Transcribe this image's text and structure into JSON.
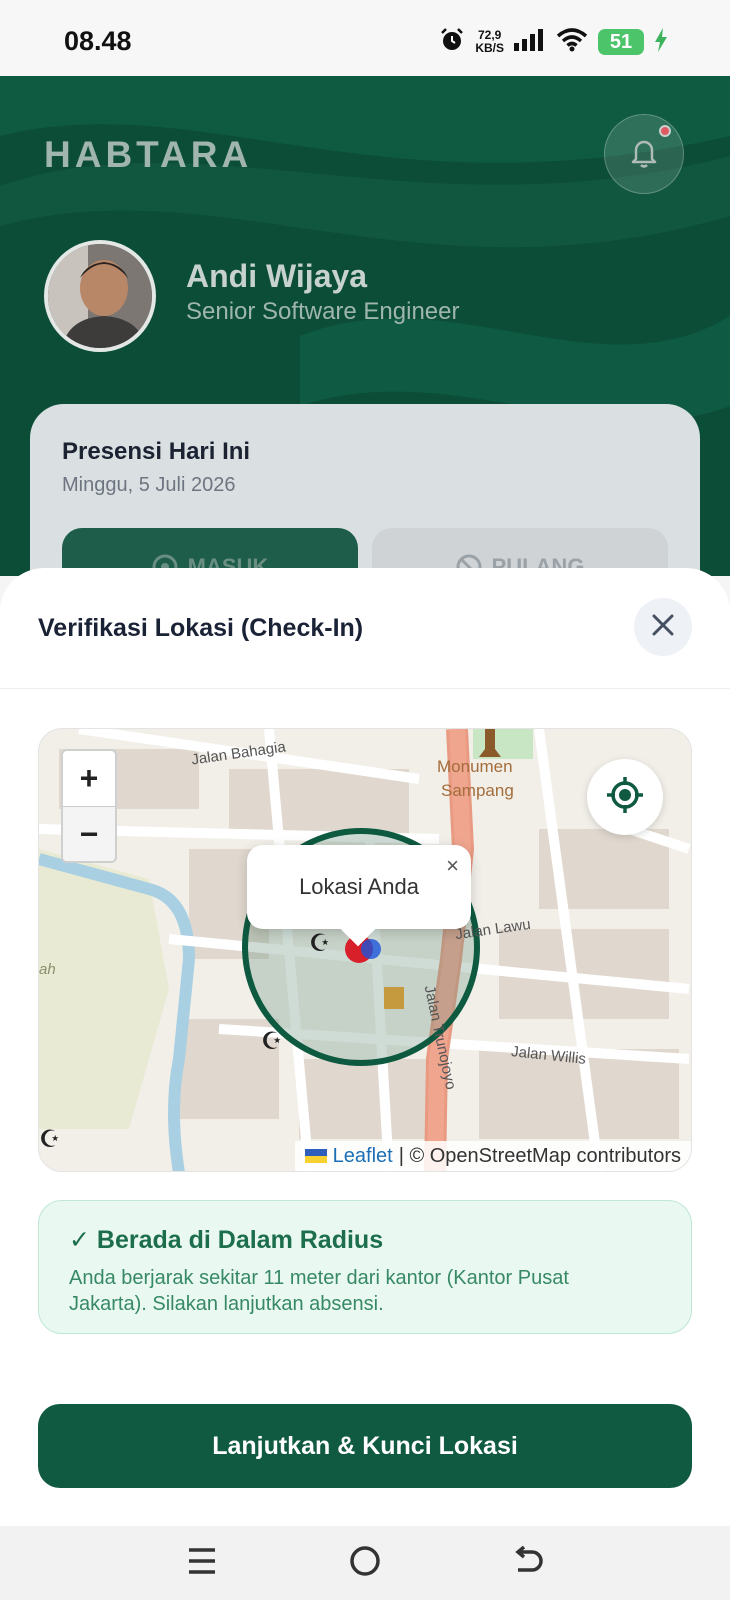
{
  "status_bar": {
    "time": "08.48",
    "speed": "72,9",
    "speed_unit": "KB/S",
    "battery": "51"
  },
  "header": {
    "brand": "HABTARA",
    "user_name": "Andi Wijaya",
    "user_role": "Senior Software Engineer"
  },
  "attendance": {
    "title": "Presensi Hari Ini",
    "date": "Minggu, 5 Juli 2026",
    "masuk_label": "MASUK",
    "pulang_label": "PULANG"
  },
  "sheet": {
    "title": "Verifikasi Lokasi (Check-In)"
  },
  "map": {
    "zoom_in": "+",
    "zoom_out": "−",
    "popup_text": "Lokasi Anda",
    "popup_close": "×",
    "attribution_link": "Leaflet",
    "attribution_text": "| © OpenStreetMap contributors",
    "labels": [
      "Jalan Bahagia",
      "Monumen",
      "Sampang",
      "Jalan Lawu",
      "Jalan Willis",
      "Jalan Trunojoyo",
      "ah"
    ]
  },
  "status": {
    "title": "✓ Berada di Dalam Radius",
    "description": "Anda berjarak sekitar 11 meter dari kantor (Kantor Pusat Jakarta). Silakan lanjutkan absensi."
  },
  "cta_label": "Lanjutkan & Kunci Lokasi",
  "colors": {
    "primary": "#0f5a41",
    "success_bg": "#e9f8f1",
    "success_text": "#1c6e4c"
  }
}
